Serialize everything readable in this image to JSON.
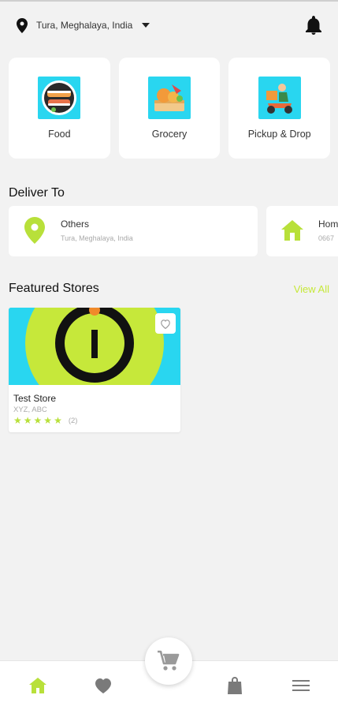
{
  "header": {
    "location": "Tura, Meghalaya, India",
    "location_icon": "location-pin-icon",
    "notification_icon": "bell-icon"
  },
  "categories": [
    {
      "label": "Food",
      "icon": "food-sushi-image"
    },
    {
      "label": "Grocery",
      "icon": "grocery-basket-image"
    },
    {
      "label": "Pickup & Drop",
      "icon": "delivery-scooter-image"
    }
  ],
  "deliver_to": {
    "title": "Deliver To",
    "addresses": [
      {
        "name": "Others",
        "address": "Tura, Meghalaya, India",
        "icon": "location-pin-icon"
      },
      {
        "name": "Hom",
        "address": "0667",
        "icon": "home-icon"
      }
    ]
  },
  "featured": {
    "title": "Featured Stores",
    "view_all": "View All",
    "stores": [
      {
        "name": "Test Store",
        "address": "XYZ, ABC",
        "rating": 5,
        "reviews": "(2)"
      }
    ]
  },
  "bottom_nav": {
    "items": [
      "home-icon",
      "heart-icon",
      "cart-icon",
      "shopping-bag-icon",
      "menu-icon"
    ],
    "active": "home-icon"
  },
  "colors": {
    "accent": "#b8e03a",
    "accent_text": "#c6e83a",
    "cyan": "#29d6f0",
    "background": "#f2f2f2"
  }
}
